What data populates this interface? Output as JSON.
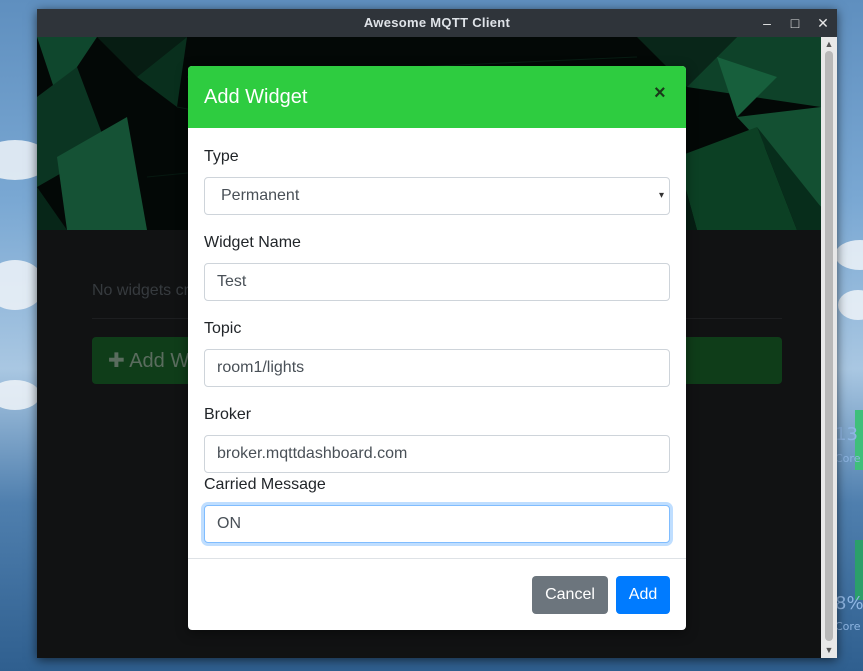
{
  "window": {
    "title": "Awesome MQTT Client",
    "minimize_icon": "minimize-icon",
    "maximize_icon": "maximize-icon",
    "close_icon": "close-icon",
    "minimize_glyph": "–",
    "maximize_glyph": "□",
    "close_glyph": "✕"
  },
  "background_app": {
    "empty_message": "No widgets cr",
    "add_button_label": "✚ Add W"
  },
  "desktop": {
    "widget_text_1": "13",
    "widget_text_2": "8%",
    "widget_sub": "Core"
  },
  "modal": {
    "title": "Add Widget",
    "close_glyph": "×",
    "type": {
      "label": "Type",
      "selected": "Permanent",
      "caret": "▾"
    },
    "widget_name": {
      "label": "Widget Name",
      "value": "Test"
    },
    "topic": {
      "label": "Topic",
      "value": "room1/lights"
    },
    "broker": {
      "label": "Broker",
      "value": "broker.mqttdashboard.com"
    },
    "carried_message": {
      "label": "Carried Message",
      "value": "ON"
    },
    "cancel_label": "Cancel",
    "add_label": "Add"
  },
  "colors": {
    "header_green": "#2ecc40",
    "primary_blue": "#007bff",
    "secondary_gray": "#6c757d",
    "banner_dark": "#08110d"
  }
}
